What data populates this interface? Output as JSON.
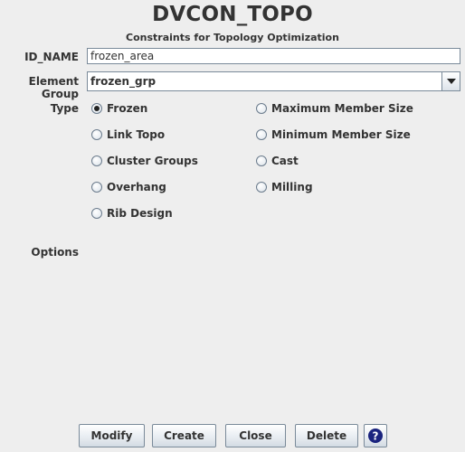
{
  "header": {
    "title": "DVCON_TOPO",
    "subtitle": "Constraints for Topology Optimization"
  },
  "form": {
    "id_name_label": "ID_NAME",
    "id_name_value": "frozen_area",
    "element_group_label": "Element Group",
    "element_group_value": "frozen_grp",
    "type_label": "Type",
    "options_label": "Options"
  },
  "type_options": {
    "frozen": "Frozen",
    "max_member": "Maximum Member Size",
    "link_topo": "Link Topo",
    "min_member": "Minimum Member Size",
    "cluster_groups": "Cluster Groups",
    "cast": "Cast",
    "overhang": "Overhang",
    "milling": "Milling",
    "rib_design": "Rib Design",
    "selected": "Frozen"
  },
  "buttons": {
    "modify": "Modify",
    "create": "Create",
    "close": "Close",
    "delete": "Delete",
    "help_icon": "help-question-icon"
  }
}
